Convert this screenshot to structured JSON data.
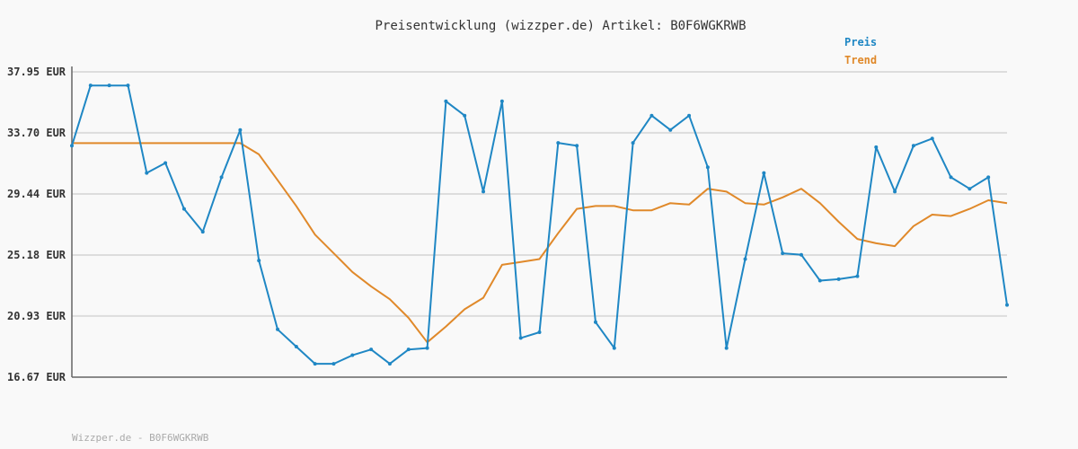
{
  "chart_data": {
    "type": "line",
    "title": "Preisentwicklung (wizzper.de) Artikel: B0F6WGKRWB",
    "ylim": [
      16.67,
      37.95
    ],
    "yticks": [
      "37.95 EUR",
      "33.70 EUR",
      "29.44 EUR",
      "25.18 EUR",
      "20.93 EUR",
      "16.67 EUR"
    ],
    "ytick_values": [
      37.95,
      33.7,
      29.44,
      25.18,
      20.93,
      16.67
    ],
    "grid": true,
    "legend_position": "top-right",
    "series": [
      {
        "name": "Preis",
        "color": "#1f87c4",
        "values": [
          32.8,
          37.0,
          37.0,
          37.0,
          30.9,
          31.6,
          28.4,
          26.8,
          30.6,
          33.9,
          24.8,
          20.0,
          18.8,
          17.6,
          17.6,
          18.2,
          18.6,
          17.6,
          18.6,
          18.7,
          35.9,
          34.9,
          29.6,
          35.9,
          19.4,
          19.8,
          33.0,
          32.8,
          20.5,
          18.7,
          33.0,
          34.9,
          33.9,
          34.9,
          31.3,
          18.7,
          24.9,
          30.9,
          25.3,
          25.2,
          23.4,
          23.5,
          23.7,
          32.7,
          29.6,
          32.8,
          33.3,
          30.6,
          29.8,
          30.6,
          21.7
        ]
      },
      {
        "name": "Trend",
        "color": "#e0892a",
        "values": [
          32.98,
          32.98,
          32.98,
          32.98,
          32.98,
          32.98,
          32.98,
          32.98,
          32.98,
          32.98,
          32.2,
          30.4,
          28.6,
          26.6,
          25.3,
          24.0,
          23.0,
          22.1,
          20.8,
          19.1,
          20.2,
          21.4,
          22.2,
          24.5,
          24.7,
          24.9,
          26.7,
          28.4,
          28.6,
          28.6,
          28.3,
          28.3,
          28.8,
          28.7,
          29.8,
          29.6,
          28.8,
          28.7,
          29.2,
          29.8,
          28.8,
          27.5,
          26.3,
          26.0,
          25.8,
          27.2,
          28.0,
          27.9,
          28.4,
          29.0,
          28.8
        ]
      }
    ]
  },
  "legend": {
    "preis_label": "Preis",
    "trend_label": "Trend"
  },
  "footer": {
    "text": "Wizzper.de - B0F6WGKRWB"
  }
}
